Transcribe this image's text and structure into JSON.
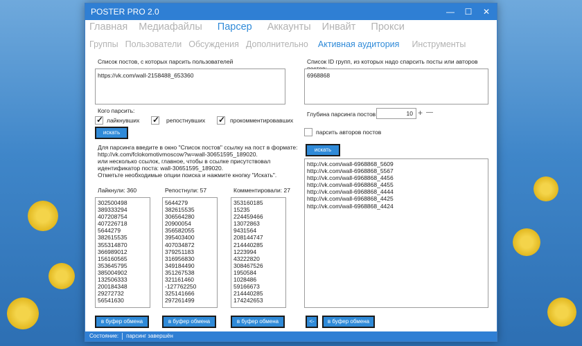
{
  "window": {
    "title": "POSTER PRO 2.0",
    "minimize_glyph": "—",
    "maximize_glyph": "☐",
    "close_glyph": "✕"
  },
  "main_tabs": [
    {
      "label": "Главная",
      "active": false
    },
    {
      "label": "Медиафайлы",
      "active": false
    },
    {
      "label": "Парсер",
      "active": true
    },
    {
      "label": "Аккаунты",
      "active": false
    },
    {
      "label": "Инвайт",
      "active": false
    },
    {
      "label": "Прокси",
      "active": false
    }
  ],
  "sub_tabs": [
    {
      "label": "Группы",
      "active": false
    },
    {
      "label": "Пользователи",
      "active": false
    },
    {
      "label": "Обсуждения",
      "active": false
    },
    {
      "label": "Дополнительно",
      "active": false
    },
    {
      "label": "Активная аудитория",
      "active": true
    },
    {
      "label": "Инструменты",
      "active": false
    }
  ],
  "left": {
    "posts_label": "Список постов, с которых парсить пользователей",
    "posts_value": "https://vk.com/wall-2158488_653360",
    "who_label": "Кого парсить:",
    "checkboxes": [
      {
        "label": "лайкнувших",
        "checked": true
      },
      {
        "label": "репостнувших",
        "checked": true
      },
      {
        "label": "прокомментировавших",
        "checked": true
      }
    ],
    "search_button": "искать",
    "help_lines": [
      "Для парсинга введите в окно \"Список постов\" ссылку на пост в формате:",
      "http://vk.com/fclokomotivmoscow?w=wall-30651595_189020.",
      "или несколько ссылок, главное, чтобы в ссылке присутствовал",
      "идентификатор поста: wall-30651595_189020.",
      "Отметьте необходимые опции поиска и нажмите кнопку \"Искать\"."
    ],
    "likes_header": "Лайкнули: 360",
    "reposts_header": "Репостнули: 57",
    "comments_header": "Комментировали: 27",
    "likes": [
      "302500498",
      "389333294",
      "407208754",
      "407226718",
      "5644279",
      "382615535",
      "355314870",
      "366989012",
      "156160565",
      "353645795",
      "385004902",
      "132506333",
      "200184348",
      "29272732",
      "56541630"
    ],
    "reposts": [
      "5644279",
      "382615535",
      "306564280",
      "20900054",
      "356582055",
      "395403400",
      "407034872",
      "379251183",
      "316956830",
      "349184490",
      "351267538",
      "321161460",
      "-127762250",
      "325141666",
      "297261499"
    ],
    "comments": [
      "353160185",
      "15235",
      "224459466",
      "13072863",
      "9431564",
      "208144747",
      "214440285",
      "1223994",
      "43222820",
      "308467526",
      "1950584",
      "1028486",
      "59166673",
      "214440285",
      "174242653"
    ],
    "copy_button": "в буфер обмена"
  },
  "right": {
    "groups_label": "Список ID групп, из которых надо спарсить посты или авторов постов:",
    "groups_value": "6968868",
    "depth_label": "Глубина парсинга постов:",
    "depth_value": "10",
    "plus_glyph": "+",
    "minus_glyph": "—",
    "authors_label": "парсить авторов постов",
    "authors_checked": false,
    "search_button": "искать",
    "results": [
      "http://vk.com/wall-6968868_5609",
      "http://vk.com/wall-6968868_5567",
      "http://vk.com/wall-6968868_4456",
      "http://vk.com/wall-6968868_4455",
      "http://vk.com/wall-6968868_4444",
      "http://vk.com/wall-6968868_4425",
      "http://vk.com/wall-6968868_4424"
    ],
    "back_button": "<-",
    "copy_button": "в буфер обмена"
  },
  "status": {
    "label": "Состояние:",
    "value": "парсинг завершён"
  },
  "colors": {
    "accent": "#2f8ad8",
    "titlebar": "#2f7fd4",
    "inactive_tab": "#b2b2b2"
  }
}
